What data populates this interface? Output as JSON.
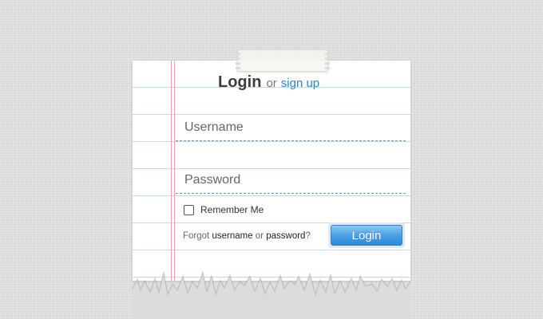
{
  "header": {
    "title": "Login",
    "or_text": "or",
    "signup_link": "sign up"
  },
  "form": {
    "username_placeholder": "Username",
    "password_placeholder": "Password",
    "remember_label": "Remember Me",
    "remember_checked": false,
    "login_button": "Login"
  },
  "footer": {
    "forgot_text": "Forgot",
    "username_link": "username",
    "or_text": "or",
    "password_link": "password",
    "question_mark": "?"
  },
  "colors": {
    "background": "#dddcdc",
    "paper": "#ffffff",
    "rule_line": "#bfdbe6",
    "margin_line": "#e7a6a6",
    "link": "#2a87c8",
    "button": "#3a95e0"
  }
}
